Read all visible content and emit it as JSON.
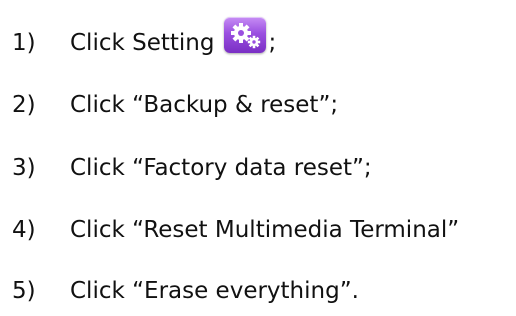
{
  "steps": [
    {
      "number": "1)",
      "text": "Click Setting",
      "suffix": ";",
      "icon": "settings-gear-icon",
      "icon_color": "#9a4fe0"
    },
    {
      "number": "2)",
      "text": "Click “Backup & reset”;"
    },
    {
      "number": "3)",
      "text": "Click “Factory data reset”;"
    },
    {
      "number": "4)",
      "text": "Click “Reset Multimedia Terminal”"
    },
    {
      "number": "5)",
      "text": "Click “Erase everything”."
    }
  ]
}
